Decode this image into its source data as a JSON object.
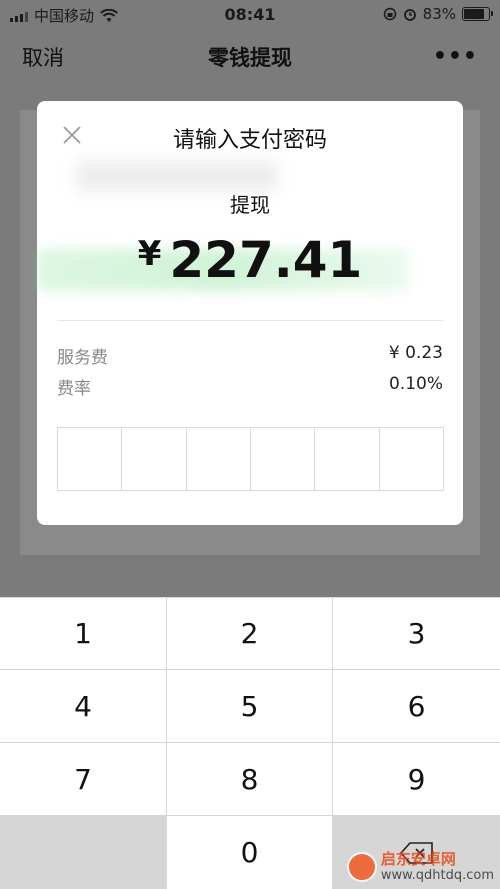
{
  "status_bar": {
    "carrier": "中国移动",
    "time": "08:41",
    "battery_percent": "83%",
    "battery_level": 0.83
  },
  "nav": {
    "cancel_label": "取消",
    "title": "零钱提现",
    "more_label": "•••"
  },
  "dialog": {
    "title": "请输入支付密码",
    "withdraw_label": "提现",
    "currency_symbol": "¥",
    "amount": "227.41",
    "fee_label": "服务费",
    "fee_value": "¥ 0.23",
    "rate_label": "费率",
    "rate_value": "0.10%",
    "pin_length": 6
  },
  "keypad": {
    "keys": [
      "1",
      "2",
      "3",
      "4",
      "5",
      "6",
      "7",
      "8",
      "9",
      "",
      "0",
      "backspace"
    ]
  },
  "watermark": {
    "name": "启东安卓网",
    "url": "www.qdhtdq.com"
  },
  "colors": {
    "overlay": "#7b7b7b",
    "dialog_bg": "#ffffff",
    "keypad_bg": "#d6d6d6"
  }
}
